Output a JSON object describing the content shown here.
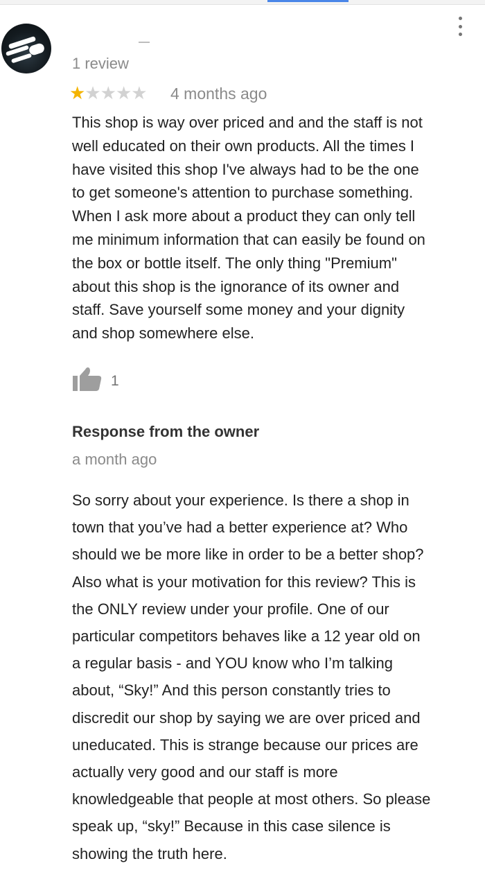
{
  "review": {
    "review_count": "1 review",
    "rating": 1,
    "rating_max": 5,
    "date": "4 months ago",
    "text": "This shop is way over priced and and the staff is not\nwell educated on their own products. All the times I\nhave visited this shop I've always had to be the one\nto get someone's attention to purchase something.\nWhen I ask more about a product they can only tell\nme minimum information that can easily be found on\nthe box or bottle itself. The only thing \"Premium\"\nabout this shop is the ignorance of its owner and\nstaff. Save yourself some money and your dignity\nand shop somewhere else.",
    "like_count": "1",
    "colors": {
      "star_filled": "#f4b400",
      "star_empty": "#d2d2d2",
      "muted_text": "#8a8a8a"
    }
  },
  "owner_response": {
    "heading": "Response from the owner",
    "date": "a month ago",
    "text": "So sorry about your experience. Is there a shop in\ntown that you’ve had a better experience at? Who\nshould we be more like in order to be a better shop?\nAlso what is your motivation for this review? This is\nthe ONLY review under your profile. One of our\nparticular competitors behaves like a 12 year old on\na regular basis - and YOU know who I’m talking\nabout, “Sky!” And this person constantly tries to\ndiscredit our shop by saying we are over priced and\nuneducated. This is strange because our prices are\nactually very good and our staff is more\nknowledgeable that people at most others. So please\nspeak up, “sky!” Because in this case silence is\nshowing the truth here."
  },
  "icons": {
    "menu": "more-vert-icon",
    "like": "thumbs-up-icon",
    "star": "star-icon"
  },
  "accent_color": "#4a86e8"
}
